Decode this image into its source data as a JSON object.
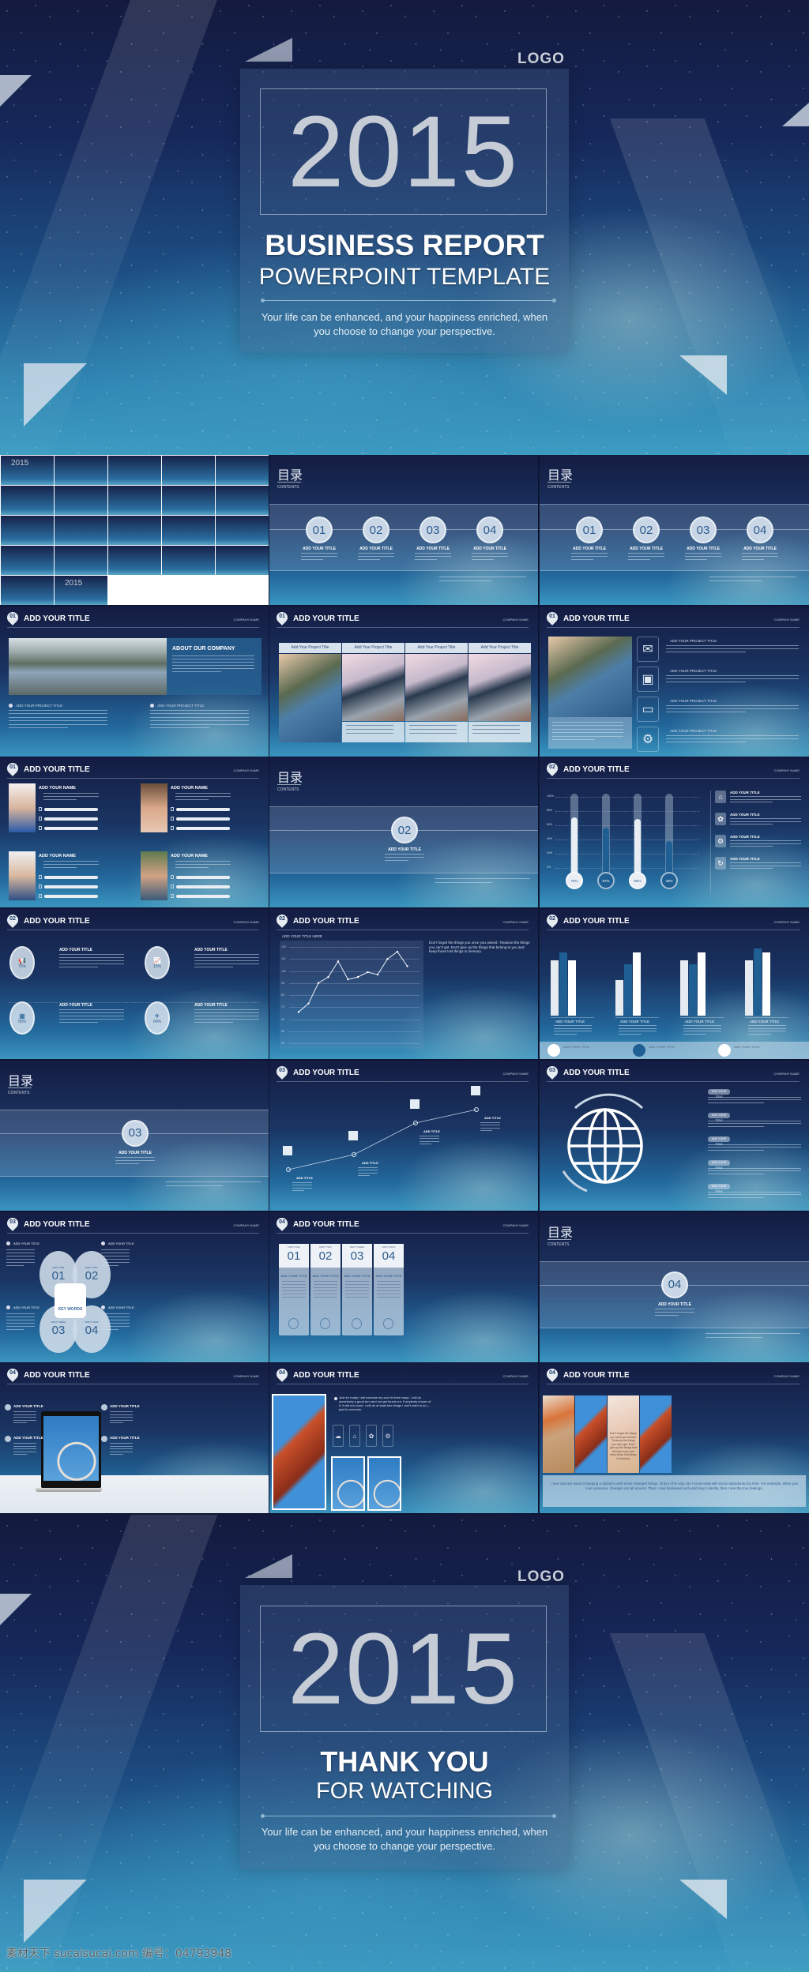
{
  "cover": {
    "logo": "LOGO",
    "year": "2015",
    "title": "BUSINESS REPORT",
    "subtitle": "POWERPOINT TEMPLATE",
    "tagline": "Your life can be enhanced, and your happiness enriched, when you choose to change your perspective."
  },
  "ending": {
    "logo": "LOGO",
    "year": "2015",
    "title": "THANK YOU",
    "subtitle": "FOR WATCHING",
    "tagline": "Your life can be enhanced, and your happiness enriched, when you choose to change your perspective."
  },
  "common": {
    "add_title": "ADD YOUR TITLE",
    "company": "COMPANY NAME",
    "contents_cn": "目录",
    "contents_en": "CONTENTS",
    "add_name": "ADD YOUR NAME",
    "add_project": "ADD YOUR PROJECT TITLE",
    "add_title_short": "ADD TITLE",
    "key_words": "KEY WORDS"
  },
  "slides": [
    {
      "kind": "overview",
      "thumb_year": "2015"
    },
    {
      "kind": "contents4",
      "numbers": [
        "01",
        "02",
        "03",
        "04"
      ]
    },
    {
      "kind": "contents4",
      "numbers": [
        "01",
        "02",
        "03",
        "04"
      ]
    },
    {
      "kind": "about",
      "section": "01",
      "heading": "ABOUT OUR COMPANY"
    },
    {
      "kind": "projects",
      "section": "01",
      "column_title": "Add Your Project Title"
    },
    {
      "kind": "iconlist",
      "section": "01",
      "icons": [
        "mail-icon",
        "floppy-icon",
        "laptop-icon",
        "gear-icon"
      ]
    },
    {
      "kind": "names",
      "section": "01"
    },
    {
      "kind": "contents1",
      "number": "02"
    },
    {
      "kind": "thermo",
      "section": "02",
      "axis": [
        "100%",
        "80%",
        "60%",
        "40%",
        "20%",
        "0%"
      ],
      "values": [
        70,
        57,
        68,
        40
      ],
      "labels": [
        "70%",
        "57%",
        "68%",
        "40%"
      ]
    },
    {
      "kind": "circles",
      "section": "02",
      "labels": [
        "75%",
        "15%",
        "50%",
        "60%"
      ]
    },
    {
      "kind": "line",
      "section": "02",
      "chart_title": "ADD YOUR TITLE HERE",
      "yticks": [
        120,
        110,
        100,
        90,
        80,
        70,
        60,
        50,
        40
      ],
      "ylim": [
        40,
        120
      ],
      "values": [
        66,
        73,
        90,
        95,
        108,
        93,
        95,
        99,
        97,
        110,
        116,
        104
      ],
      "side_text": "Don't forget the things you once you owned. Treasure the things you can't get. Don't give up the things that belong to you and keep those lost things in memory."
    },
    {
      "kind": "bars",
      "section": "02",
      "groups": [
        [
          70,
          80,
          70
        ],
        [
          45,
          65,
          80
        ],
        [
          70,
          65,
          80
        ],
        [
          70,
          85,
          80
        ]
      ],
      "colors": [
        "#e6ebf2",
        "#1f5f93",
        "#ffffff"
      ]
    },
    {
      "kind": "contents1",
      "number": "03"
    },
    {
      "kind": "timeline",
      "section": "03"
    },
    {
      "kind": "globe",
      "section": "03"
    },
    {
      "kind": "keywords",
      "section": "03",
      "numbers": [
        "01",
        "02",
        "03",
        "04"
      ],
      "parts": [
        "PART ONE",
        "PART TWO",
        "PART THREE",
        "PART FOUR"
      ]
    },
    {
      "kind": "cards",
      "section": "04",
      "numbers": [
        "01",
        "02",
        "03",
        "04"
      ],
      "parts": [
        "PART ONE",
        "PART TWO",
        "PART THREE",
        "PART FOUR"
      ]
    },
    {
      "kind": "contents1",
      "number": "04"
    },
    {
      "kind": "laptop",
      "section": "04"
    },
    {
      "kind": "photos",
      "section": "04",
      "text": "Just for today I will exercise my soul in three ways. I will do somebody a good turn and not get found out. If anybody knows of it, it will not count. I will do at least two things I don't want to do—just for exercise."
    },
    {
      "kind": "strip",
      "section": "04",
      "overlay": "Don't forget the things you once you owned. Treasure the things you can't get. Don't give up the things that belong to you and keep those lost things in memory.",
      "text": "I love and am used to keeping a distance with those changed things. Only in this way can I know what will not be abandoned by time. For example, when you love someone, changes are all around. Then I step backward and watching it silently, then I see the true feelings."
    }
  ],
  "watermark": "素材天下 sucaisucai.com  编号：04793948"
}
